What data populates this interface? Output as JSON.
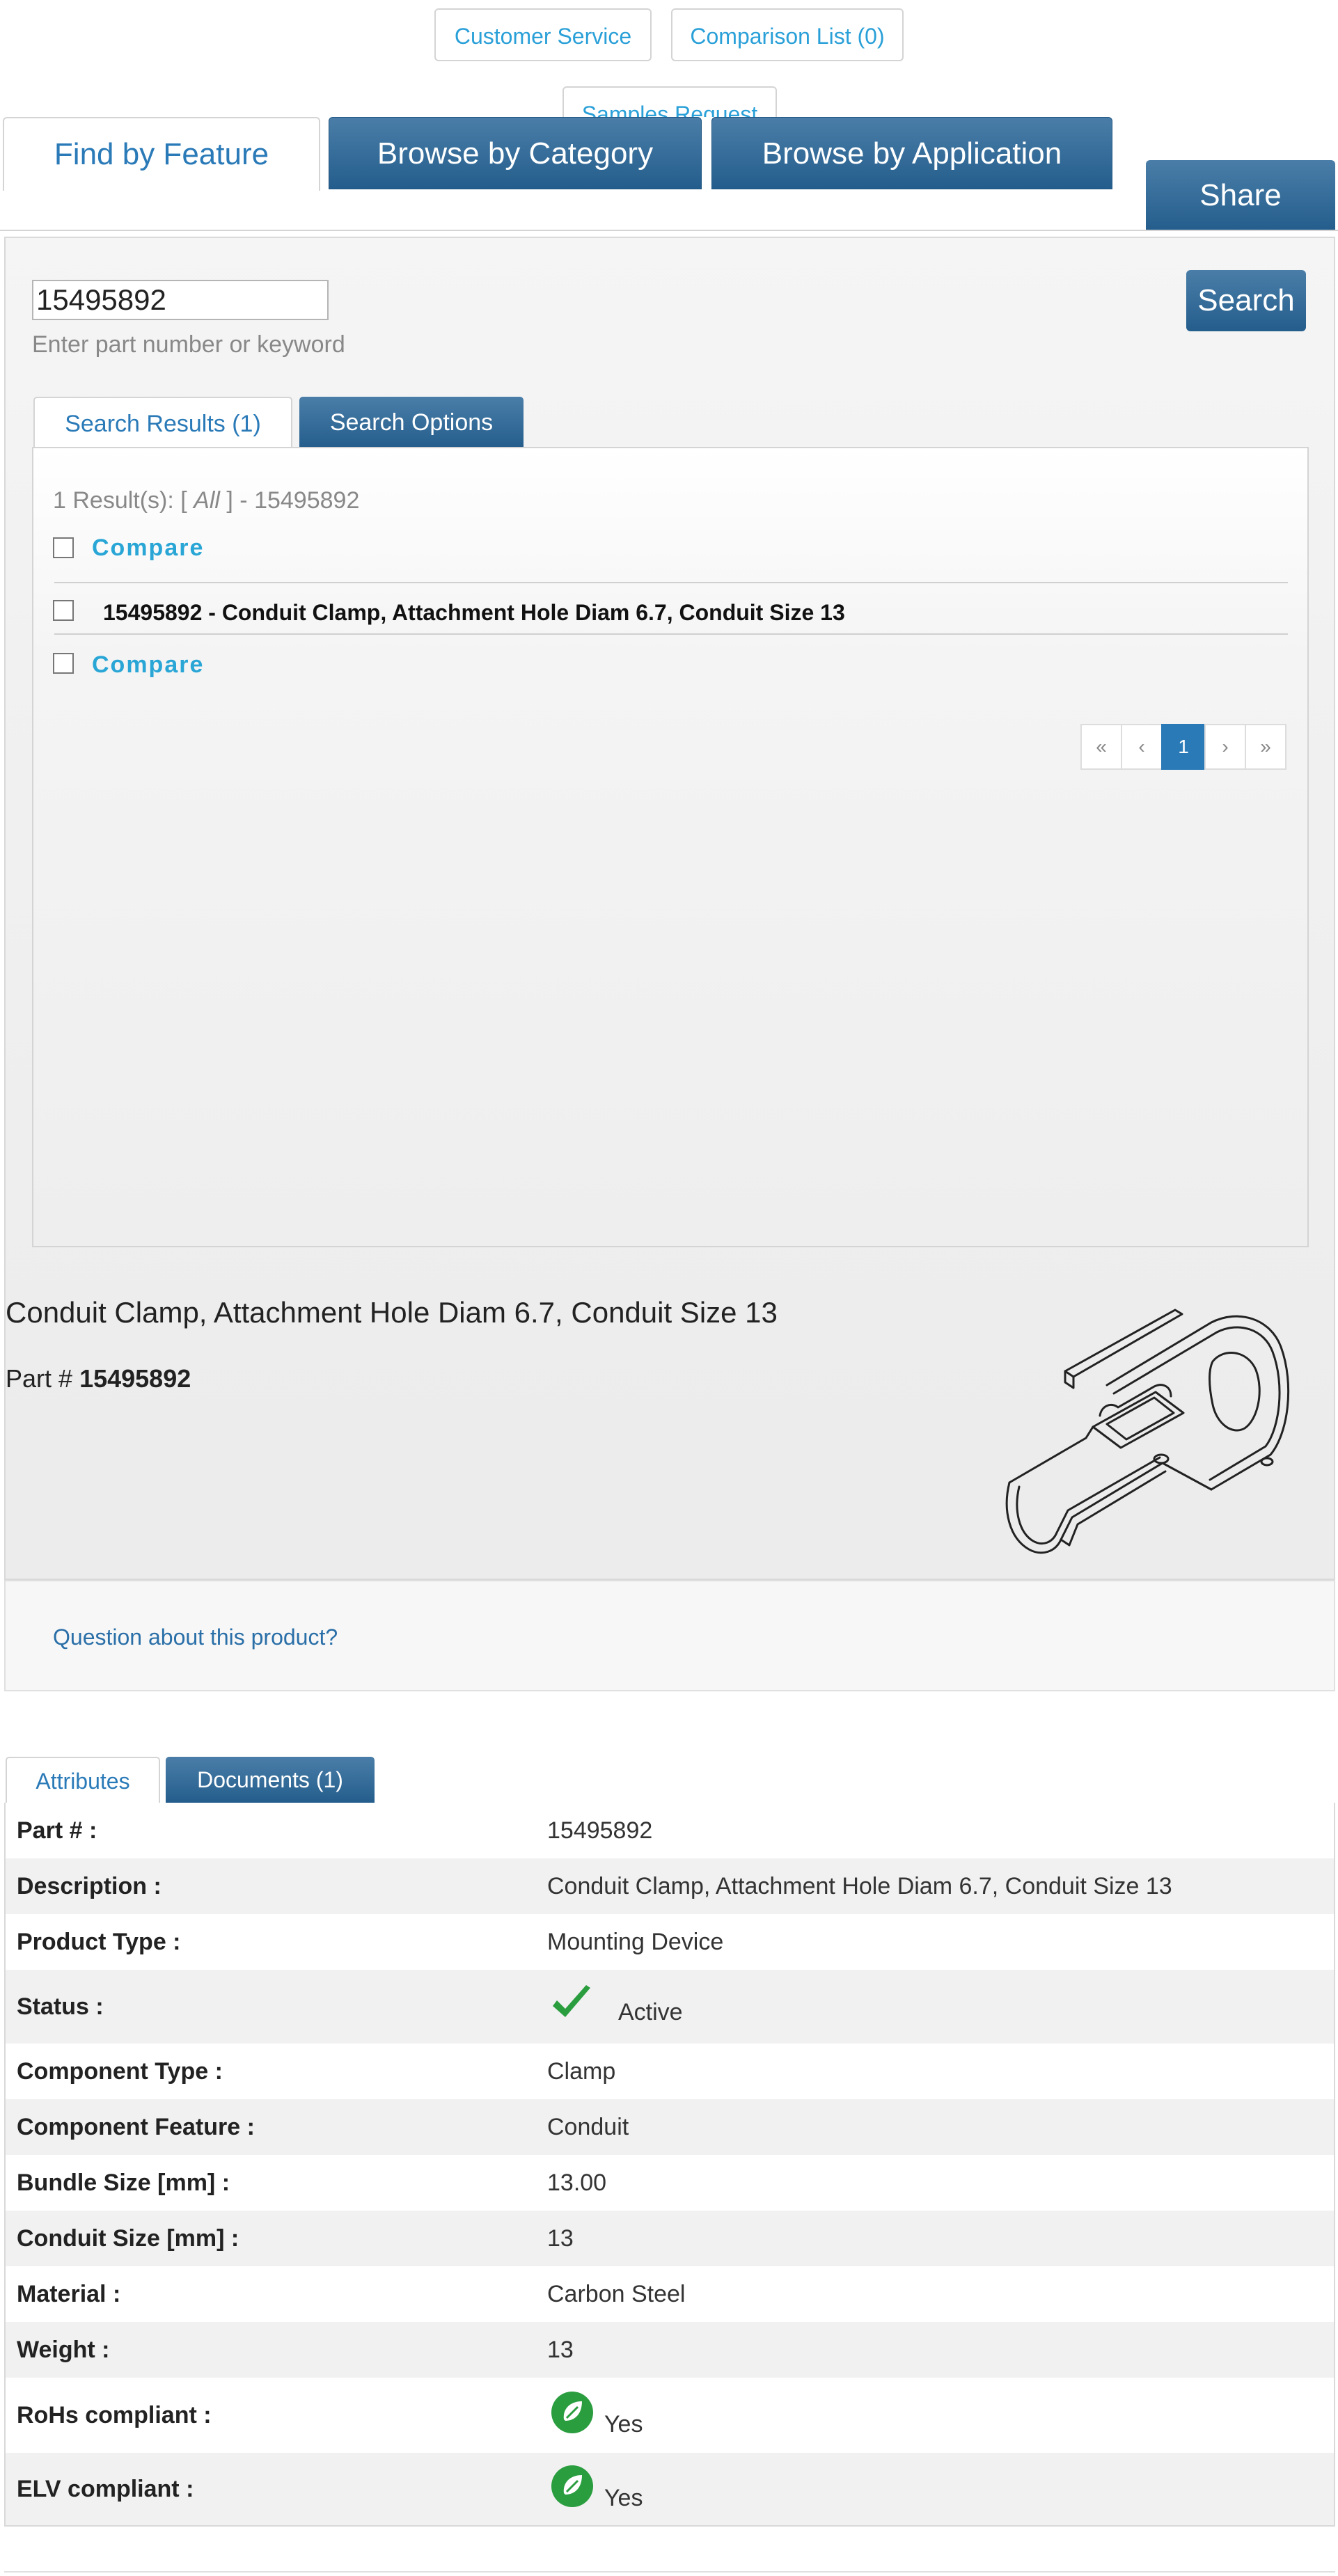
{
  "header": {
    "customer_service": "Customer Service",
    "comparison_list": "Comparison List (0)",
    "samples_request": "Samples Request"
  },
  "main_tabs": {
    "find_by_feature": "Find by Feature",
    "browse_by_category": "Browse by Category",
    "browse_by_application": "Browse by Application",
    "share": "Share"
  },
  "search": {
    "value": "15495892",
    "hint": "Enter part number or keyword",
    "button": "Search"
  },
  "sub_tabs": {
    "results": "Search Results (1)",
    "options": "Search Options"
  },
  "results": {
    "count_prefix": "1 Result(s): [ ",
    "count_filter": "All",
    "count_suffix": " ] - 15495892",
    "compare_label": "Compare",
    "item_title": "15495892 - Conduit Clamp, Attachment Hole Diam 6.7, Conduit Size 13",
    "pager": {
      "first": "«",
      "prev": "‹",
      "current": "1",
      "next": "›",
      "last": "»"
    }
  },
  "product": {
    "title": "Conduit Clamp, Attachment Hole Diam 6.7, Conduit Size 13",
    "part_label": "Part #",
    "part_number": "15495892",
    "question_link": "Question about this product?"
  },
  "attr_tabs": {
    "attributes": "Attributes",
    "documents": "Documents (1)"
  },
  "attributes": [
    {
      "label": "Part # :",
      "value": "15495892"
    },
    {
      "label": "Description :",
      "value": "Conduit Clamp, Attachment Hole Diam 6.7, Conduit Size 13"
    },
    {
      "label": "Product Type :",
      "value": "Mounting Device"
    },
    {
      "label": "Status :",
      "value": "Active",
      "icon": "checkmark-icon"
    },
    {
      "label": "Component Type :",
      "value": "Clamp"
    },
    {
      "label": "Component Feature :",
      "value": "Conduit"
    },
    {
      "label": "Bundle Size [mm] :",
      "value": "13.00"
    },
    {
      "label": "Conduit Size [mm] :",
      "value": "13"
    },
    {
      "label": "Material :",
      "value": "Carbon Steel"
    },
    {
      "label": "Weight :",
      "value": "13"
    },
    {
      "label": "RoHs compliant :",
      "value": "Yes",
      "icon": "green-leaf-badge-icon"
    },
    {
      "label": "ELV compliant :",
      "value": "Yes",
      "icon": "green-leaf-badge-icon"
    }
  ],
  "colors": {
    "accent_blue": "#2a7ab8",
    "tab_blue_dark": "#245d8c",
    "link_cyan": "#29a6d6",
    "status_green": "#2a9d3f"
  }
}
